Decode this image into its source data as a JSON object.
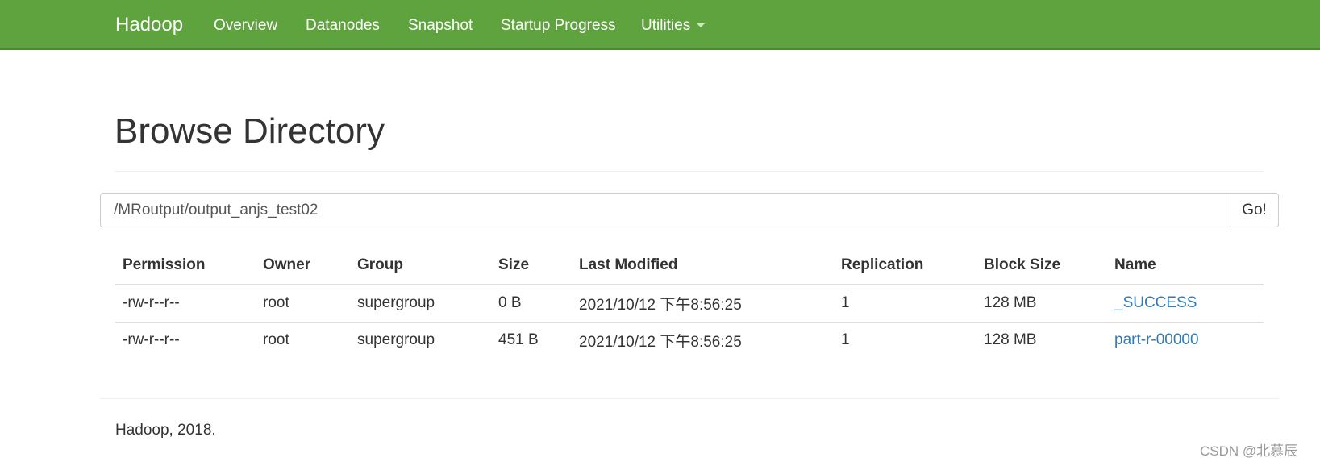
{
  "navbar": {
    "brand": "Hadoop",
    "items": [
      {
        "label": "Overview"
      },
      {
        "label": "Datanodes"
      },
      {
        "label": "Snapshot"
      },
      {
        "label": "Startup Progress"
      },
      {
        "label": "Utilities",
        "has_dropdown": true
      }
    ],
    "color": "#5fa33e"
  },
  "page": {
    "title": "Browse Directory"
  },
  "path_bar": {
    "value": "/MRoutput/output_anjs_test02",
    "go_label": "Go!"
  },
  "table": {
    "columns": [
      "Permission",
      "Owner",
      "Group",
      "Size",
      "Last Modified",
      "Replication",
      "Block Size",
      "Name"
    ],
    "rows": [
      [
        "-rw-r--r--",
        "root",
        "supergroup",
        "0 B",
        "2021/10/12 下午8:56:25",
        "1",
        "128 MB",
        "_SUCCESS"
      ],
      [
        "-rw-r--r--",
        "root",
        "supergroup",
        "451 B",
        "2021/10/12 下午8:56:25",
        "1",
        "128 MB",
        "part-r-00000"
      ]
    ],
    "link_color": "#337ab7"
  },
  "footer": {
    "text": "Hadoop, 2018."
  },
  "watermark": "CSDN @北慕辰"
}
